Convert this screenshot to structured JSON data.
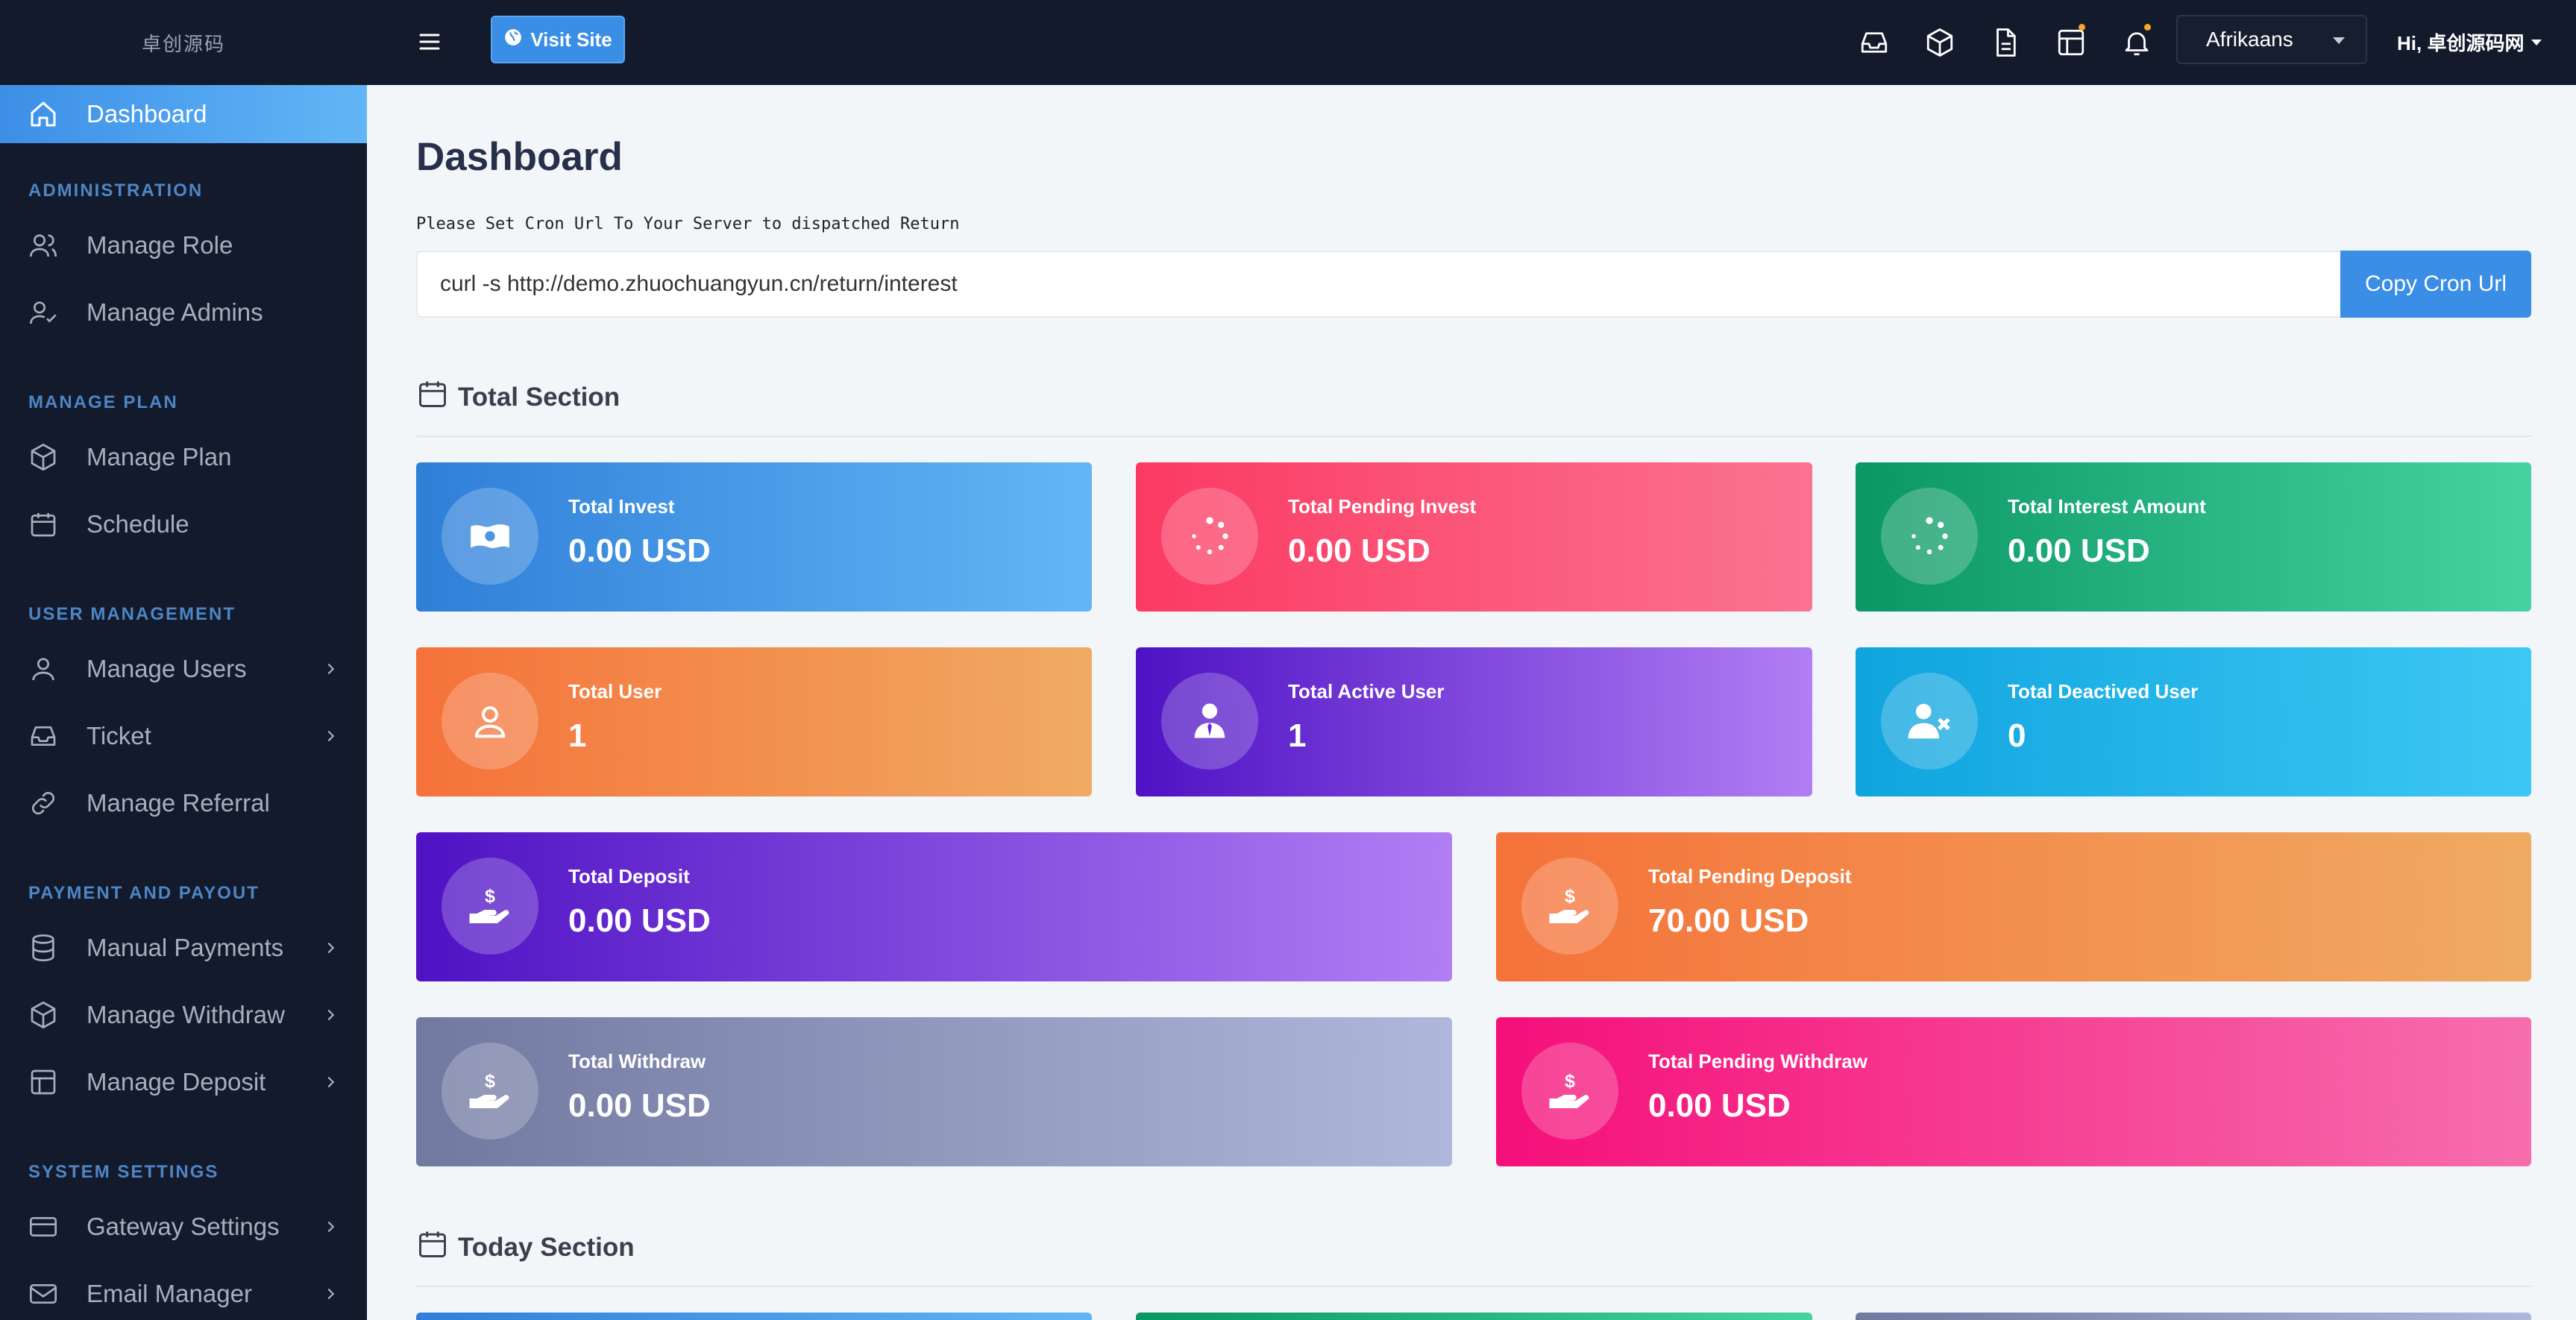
{
  "brand": "卓创源码",
  "sidebar": {
    "active": "Dashboard",
    "sections": [
      {
        "heading": "ADMINISTRATION",
        "items": [
          {
            "label": "Manage Role"
          },
          {
            "label": "Manage Admins"
          }
        ]
      },
      {
        "heading": "MANAGE PLAN",
        "items": [
          {
            "label": "Manage Plan"
          },
          {
            "label": "Schedule"
          }
        ]
      },
      {
        "heading": "USER MANAGEMENT",
        "items": [
          {
            "label": "Manage Users"
          },
          {
            "label": "Ticket"
          },
          {
            "label": "Manage Referral"
          }
        ]
      },
      {
        "heading": "PAYMENT AND PAYOUT",
        "items": [
          {
            "label": "Manual Payments"
          },
          {
            "label": "Manage Withdraw"
          },
          {
            "label": "Manage Deposit"
          }
        ]
      },
      {
        "heading": "SYSTEM SETTINGS",
        "items": [
          {
            "label": "Gateway Settings"
          },
          {
            "label": "Email Manager"
          }
        ]
      }
    ]
  },
  "topbar": {
    "visit_label": "Visit Site",
    "language": "Afrikaans",
    "greeting": "Hi, 卓创源码网"
  },
  "main": {
    "title": "Dashboard",
    "cron_label": "Please Set Cron Url To Your Server to dispatched Return",
    "cron_value": "curl -s http://demo.zhuochuangyun.cn/return/interest",
    "copy_label": "Copy Cron Url",
    "total_section": "Total Section",
    "today_section": "Today Section",
    "cards": [
      {
        "label": "Total Invest",
        "value": "0.00 USD",
        "color": "#2f7fd8"
      },
      {
        "label": "Total Pending Invest",
        "value": "0.00 USD",
        "color": "#fb3a62"
      },
      {
        "label": "Total Interest Amount",
        "value": "0.00 USD",
        "color": "#0b9765"
      },
      {
        "label": "Total User",
        "value": "1",
        "color": "#f5723a"
      },
      {
        "label": "Total Active User",
        "value": "1",
        "color": "#4f12c4"
      },
      {
        "label": "Total Deactived User",
        "value": "0",
        "color": "#10a4de"
      },
      {
        "label": "Total Deposit",
        "value": "0.00 USD",
        "color": "#4f12c4"
      },
      {
        "label": "Total Pending Deposit",
        "value": "70.00 USD",
        "color": "#f5723a"
      },
      {
        "label": "Total Withdraw",
        "value": "0.00 USD",
        "color": "#7179a0"
      },
      {
        "label": "Total Pending Withdraw",
        "value": "0.00 USD",
        "color": "#f50f7a"
      }
    ]
  }
}
